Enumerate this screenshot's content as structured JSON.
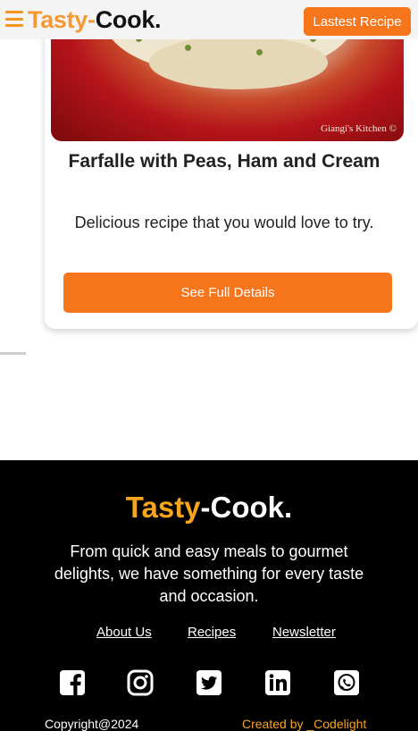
{
  "header": {
    "logo_part1": "Tasty-",
    "logo_part2": "Cook.",
    "latest_button": "Lastest Recipe"
  },
  "card": {
    "image_watermark": "Giangi's Kitchen ©",
    "title": "Farfalle with Peas, Ham and Cream",
    "description": "Delicious recipe that you would love to try.",
    "button": "See Full Details"
  },
  "footer": {
    "logo_part1": "Tasty",
    "logo_part2": "-Cook.",
    "tagline": "From quick and easy meals to gourmet delights, we have something for every taste and occasion.",
    "links": [
      "About Us",
      "Recipes",
      "Newsletter"
    ],
    "social_icons": [
      "facebook-icon",
      "instagram-icon",
      "twitter-icon",
      "linkedin-icon",
      "whatsapp-icon"
    ],
    "copyright": "Copyright@2024",
    "credit": "Created by _Codelight"
  },
  "colors": {
    "accent": "#f7761c",
    "logo_accent": "#f39a34",
    "footer_bg": "#000000"
  }
}
